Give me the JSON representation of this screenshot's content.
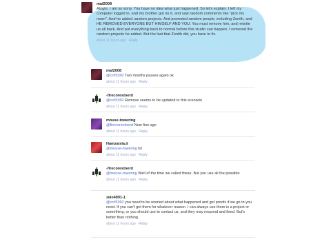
{
  "main_comment": {
    "user": "maf2008",
    "text": "Alright, I am so sorry. You have no idea what just happened. So let's explain. I left my computer logged in, and my brother got on it, and saw random comments like \"pick my room\". And he added random projects. And promoted random people, including Zenith, and HE REMOVED EVERYONE BUT HIMSELF AND YOU. You must remove him, and rewrite us all back. And put everything back to normal before this studio can happen. I removed the random projects he added. But the last that Zenith did, you have to fix.",
    "time": "about 11 hours ago",
    "reply_label": "Reply"
  },
  "replies": [
    {
      "user": "maf2008",
      "mention": "@cr#5360",
      "text": "Two months passes again ok",
      "time": "about 11 hours ago",
      "reply_label": "Reply"
    },
    {
      "user": "-firecorestoerd",
      "mention": "@cr#5360",
      "text": "Remove seems to be updated to this scenario",
      "time": "about 11 hours ago",
      "reply_label": "Reply"
    },
    {
      "user": "mouse-towering",
      "mention": "@firecorestoerd",
      "text": "Now fine ago",
      "time": "about 11 hours ago",
      "reply_label": "Reply"
    },
    {
      "user": "Hamzaisla.it",
      "mention": "@mouse-towering",
      "text": "lol",
      "time": "about 11 hours ago",
      "reply_label": "Reply"
    },
    {
      "user": "-firecorestoerd",
      "mention": "@mouse-towering",
      "text": "Well of the time we called these. But you use all the possible",
      "time": "about 11 hours ago",
      "reply_label": "Reply"
    },
    {
      "user": "zelo4991-1",
      "mention": "@cr#5360",
      "text": "you need to be worried about what happened and get proofs if we go to you need. If you can't get them for whatever reason. I can always use there is a project or something, or you should use to contact us, and they may respond and fixed. But's better than nothing.",
      "time": "about 11 hours ago",
      "reply_label": "Reply"
    }
  ]
}
